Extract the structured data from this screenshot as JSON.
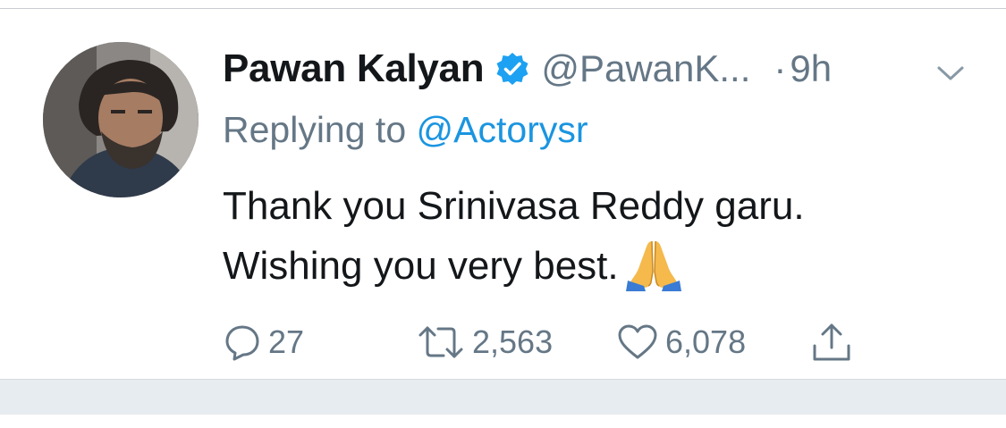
{
  "tweet": {
    "display_name": "Pawan Kalyan",
    "handle": "@PawanK...",
    "separator": "·",
    "time": "9h",
    "replying_prefix": "Replying to",
    "replying_handle": "@Actorysr",
    "text_line_1": "Thank you Srinivasa Reddy garu.",
    "text_line_2": "Wishing you very best.",
    "emoji": "folded-hands-icon"
  },
  "actions": {
    "reply_count": "27",
    "retweet_count": "2,563",
    "like_count": "6,078"
  },
  "colors": {
    "text_primary": "#14171a",
    "text_secondary": "#657786",
    "link": "#1b95e0",
    "verified": "#1da1f2",
    "footer_band": "#e6ecf0"
  }
}
